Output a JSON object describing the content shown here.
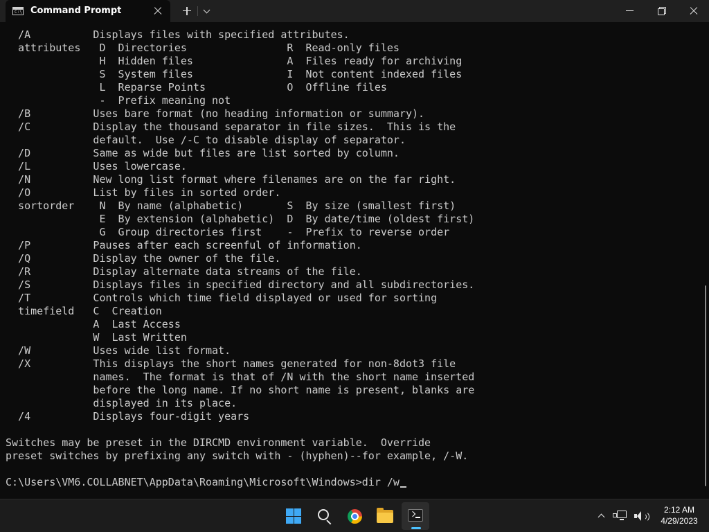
{
  "window": {
    "tab_title": "Command Prompt",
    "icons": {
      "tab": "cmd-icon",
      "tab_close": "close-icon",
      "new_tab": "plus-icon",
      "dropdown": "chevron-down-icon",
      "minimize": "minimize-icon",
      "maximize": "maximize-icon",
      "close": "close-icon"
    }
  },
  "terminal": {
    "lines": [
      "  /A          Displays files with specified attributes.",
      "  attributes   D  Directories                R  Read-only files",
      "               H  Hidden files               A  Files ready for archiving",
      "               S  System files               I  Not content indexed files",
      "               L  Reparse Points             O  Offline files",
      "               -  Prefix meaning not",
      "  /B          Uses bare format (no heading information or summary).",
      "  /C          Display the thousand separator in file sizes.  This is the",
      "              default.  Use /-C to disable display of separator.",
      "  /D          Same as wide but files are list sorted by column.",
      "  /L          Uses lowercase.",
      "  /N          New long list format where filenames are on the far right.",
      "  /O          List by files in sorted order.",
      "  sortorder    N  By name (alphabetic)       S  By size (smallest first)",
      "               E  By extension (alphabetic)  D  By date/time (oldest first)",
      "               G  Group directories first    -  Prefix to reverse order",
      "  /P          Pauses after each screenful of information.",
      "  /Q          Display the owner of the file.",
      "  /R          Display alternate data streams of the file.",
      "  /S          Displays files in specified directory and all subdirectories.",
      "  /T          Controls which time field displayed or used for sorting",
      "  timefield   C  Creation",
      "              A  Last Access",
      "              W  Last Written",
      "  /W          Uses wide list format.",
      "  /X          This displays the short names generated for non-8dot3 file",
      "              names.  The format is that of /N with the short name inserted",
      "              before the long name. If no short name is present, blanks are",
      "              displayed in its place.",
      "  /4          Displays four-digit years",
      "",
      "Switches may be preset in the DIRCMD environment variable.  Override",
      "preset switches by prefixing any switch with - (hyphen)--for example, /-W.",
      ""
    ],
    "prompt": "C:\\Users\\VM6.COLLABNET\\AppData\\Roaming\\Microsoft\\Windows>dir /w"
  },
  "taskbar": {
    "apps": [
      {
        "name": "start",
        "icon": "windows-start-icon"
      },
      {
        "name": "search",
        "icon": "search-icon"
      },
      {
        "name": "chrome",
        "icon": "chrome-icon"
      },
      {
        "name": "file-explorer",
        "icon": "folder-icon"
      },
      {
        "name": "terminal",
        "icon": "terminal-icon",
        "active": true
      }
    ],
    "tray_icons": [
      "chevron-up-icon",
      "network-icon",
      "volume-icon"
    ],
    "clock": {
      "time": "2:12 AM",
      "date": "4/29/2023"
    }
  },
  "colors": {
    "terminal_bg": "#0c0c0c",
    "terminal_fg": "#cccccc",
    "titlebar_bg": "#202020",
    "taskbar_bg": "#1c1c1c",
    "accent": "#4cc2ff"
  }
}
